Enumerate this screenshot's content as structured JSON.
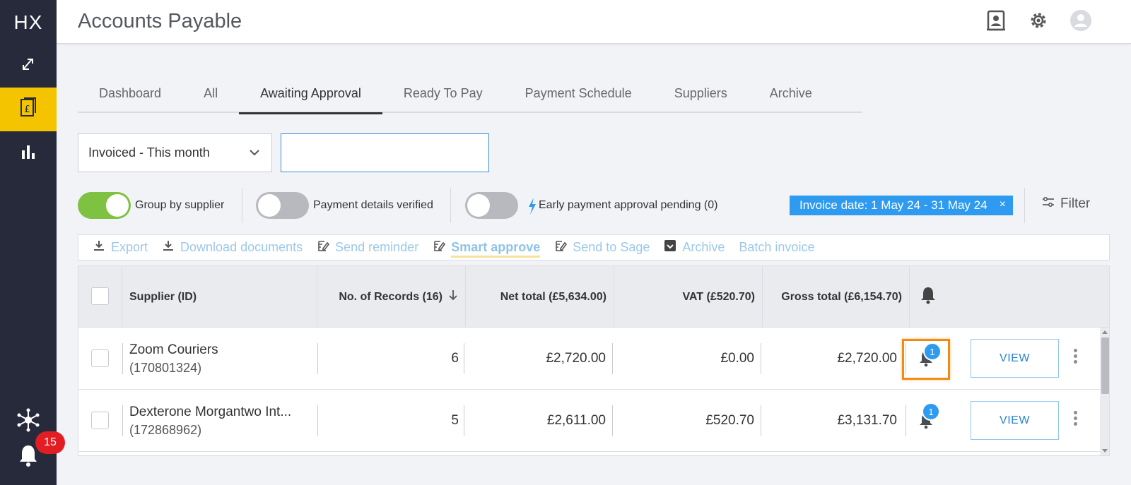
{
  "sidebar": {
    "logo": "HX",
    "badge_count": "15",
    "accent": "#f5c400"
  },
  "header": {
    "title": "Accounts Payable"
  },
  "tabs": [
    {
      "label": "Dashboard"
    },
    {
      "label": "All"
    },
    {
      "label": "Awaiting Approval",
      "active": true
    },
    {
      "label": "Ready To Pay"
    },
    {
      "label": "Payment Schedule"
    },
    {
      "label": "Suppliers"
    },
    {
      "label": "Archive"
    }
  ],
  "filters": {
    "period_select": "Invoiced - This month",
    "search_value": "",
    "toggles": [
      {
        "label": "Group by supplier",
        "on": true
      },
      {
        "label": "Payment details verified",
        "on": false
      },
      {
        "label": "Early payment approval pending (0)",
        "on": false
      }
    ],
    "chip": "Invoice date: 1 May 24 - 31 May 24",
    "chip_close": "×",
    "filter_label": "Filter"
  },
  "toolbar": {
    "export": "Export",
    "download": "Download documents",
    "reminder": "Send reminder",
    "smart_approve": "Smart approve",
    "send_sage": "Send to Sage",
    "archive": "Archive",
    "batch_invoice": "Batch invoice"
  },
  "table": {
    "headers": {
      "supplier": "Supplier (ID)",
      "records": "No. of Records (16)",
      "net": "Net total (£5,634.00)",
      "vat": "VAT (£520.70)",
      "gross": "Gross total (£6,154.70)"
    },
    "rows": [
      {
        "name": "Zoom Couriers",
        "id": "(170801324)",
        "records": "6",
        "net": "£2,720.00",
        "vat": "£0.00",
        "gross": "£2,720.00",
        "notifications": "1",
        "view": "VIEW"
      },
      {
        "name": "Dexterone Morgantwo Int...",
        "id": "(172868962)",
        "records": "5",
        "net": "£2,611.00",
        "vat": "£520.70",
        "gross": "£3,131.70",
        "notifications": "1",
        "view": "VIEW"
      }
    ]
  }
}
